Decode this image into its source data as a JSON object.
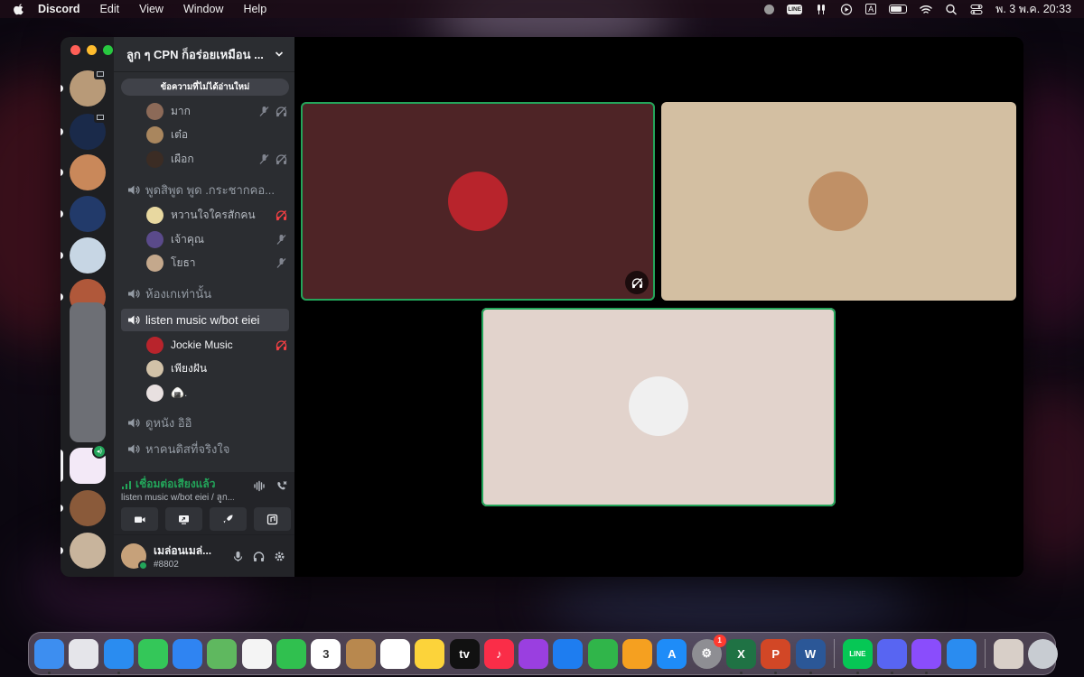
{
  "menubar": {
    "app_name": "Discord",
    "menus": [
      "Edit",
      "View",
      "Window",
      "Help"
    ],
    "status_icons": [
      "record-icon",
      "line-icon",
      "airpods-icon",
      "play-icon",
      "input-source-icon",
      "battery-icon",
      "wifi-icon",
      "search-icon",
      "control-center-icon"
    ],
    "input_source": "A",
    "clock": "พ. 3 พ.ค.  20:33"
  },
  "server_list": {
    "items": [
      {
        "name": "server-1",
        "color": "#b89a78",
        "screen_badge": true
      },
      {
        "name": "server-2",
        "color": "#1a2a4a",
        "screen_badge": true
      },
      {
        "name": "server-3",
        "color": "#c9885a"
      },
      {
        "name": "server-4",
        "color": "#223a6a"
      },
      {
        "name": "server-5",
        "color": "#c7d6e4"
      },
      {
        "name": "server-6",
        "color": "#b0583a"
      },
      {
        "name": "server-active",
        "color": "#f3e9f7",
        "voice_active": true
      },
      {
        "name": "server-8",
        "color": "#8a5a3a"
      },
      {
        "name": "server-9",
        "color": "#c8b49c"
      }
    ]
  },
  "guild": {
    "name": "ลูก ๆ CPN ก็อร่อยเหมือน ...",
    "unread_banner": "ข้อความที่ไม่ได้อ่านใหม่"
  },
  "channels": [
    {
      "type": "voice-user",
      "name": "มาก",
      "avatar_color": "#8c6a58",
      "muted": true,
      "deafened": true
    },
    {
      "type": "voice-user",
      "name": "เต๋อ",
      "avatar_color": "#a9865e"
    },
    {
      "type": "voice-user",
      "name": "เผือก",
      "avatar_color": "#3b2c24",
      "muted": true,
      "deafened": true
    },
    {
      "type": "voice-channel",
      "name": "พูดสิพูด พูด .กระชากคอ..."
    },
    {
      "type": "voice-user",
      "name": "หวานใจใครสักคน",
      "avatar_color": "#e8d8a0",
      "deafened_red": true
    },
    {
      "type": "voice-user",
      "name": "เจ้าคุณ",
      "avatar_color": "#5a4a8a",
      "muted": true
    },
    {
      "type": "voice-user",
      "name": "โยธา",
      "avatar_color": "#c4a88c",
      "muted": true
    },
    {
      "type": "voice-channel",
      "name": "ห้องเกเท่านั้น"
    },
    {
      "type": "voice-channel",
      "name": "listen music w/bot eiei",
      "active": true
    },
    {
      "type": "voice-user",
      "name": "Jockie Music",
      "avatar_color": "#b8242c",
      "deafened_red": true
    },
    {
      "type": "voice-user",
      "name": "เพียงฝัน",
      "avatar_color": "#d2c2a8"
    },
    {
      "type": "voice-user",
      "name": "🍙.",
      "avatar_color": "#e8e0e0"
    },
    {
      "type": "voice-channel",
      "name": "ดูหนัง อิอิ"
    },
    {
      "type": "voice-channel",
      "name": "หาคนดิสที่จริงใจ"
    }
  ],
  "voice_panel": {
    "status": "เชื่อมต่อเสียงแล้ว",
    "subtitle": "listen music w/bot eiei / ลูก...",
    "actions": [
      "camera-icon",
      "screen-share-icon",
      "activity-icon",
      "soundboard-icon"
    ]
  },
  "user_panel": {
    "name": "เมล่อนเมล่...",
    "tag": "#8802"
  },
  "stage": {
    "tiles": [
      {
        "name": "tile-jockie-music",
        "bg": "#4e2426",
        "speaking": true,
        "avatar_color": "#b8242c",
        "deafened": true
      },
      {
        "name": "tile-capybara",
        "bg": "#d3bfa2",
        "speaking": false,
        "avatar_color": "#c09066"
      },
      {
        "name": "tile-anime-user",
        "bg": "#e2d3cc",
        "speaking": true,
        "avatar_color": "#f0f0f0"
      }
    ],
    "speaking_color": "#23a55a"
  },
  "dock": {
    "apps": [
      {
        "name": "finder",
        "color": "#3d8ef0",
        "glyph": "",
        "running": true
      },
      {
        "name": "launchpad",
        "color": "#e5e5ea",
        "glyph": ""
      },
      {
        "name": "safari",
        "color": "#2a8cf0",
        "glyph": "",
        "running": true
      },
      {
        "name": "messages",
        "color": "#34c759",
        "glyph": ""
      },
      {
        "name": "mail",
        "color": "#2f84f2",
        "glyph": ""
      },
      {
        "name": "maps",
        "color": "#5fb85f",
        "glyph": ""
      },
      {
        "name": "photos",
        "color": "#f4f4f4",
        "glyph": ""
      },
      {
        "name": "facetime",
        "color": "#30c04f",
        "glyph": ""
      },
      {
        "name": "calendar",
        "color": "#ffffff",
        "glyph": "3"
      },
      {
        "name": "contacts",
        "color": "#b8884e",
        "glyph": ""
      },
      {
        "name": "reminders",
        "color": "#ffffff",
        "glyph": ""
      },
      {
        "name": "notes",
        "color": "#fcd33a",
        "glyph": ""
      },
      {
        "name": "apple-tv",
        "color": "#111111",
        "glyph": "tv"
      },
      {
        "name": "music",
        "color": "#fa2d48",
        "glyph": "♪"
      },
      {
        "name": "podcasts",
        "color": "#9a3fe0",
        "glyph": ""
      },
      {
        "name": "keynote",
        "color": "#1e7df0",
        "glyph": ""
      },
      {
        "name": "numbers",
        "color": "#30b54a",
        "glyph": ""
      },
      {
        "name": "pages",
        "color": "#f5a020",
        "glyph": ""
      },
      {
        "name": "app-store",
        "color": "#1e8cf8",
        "glyph": "A"
      },
      {
        "name": "system-preferences",
        "color": "#8e8e93",
        "glyph": "⚙",
        "badge": "1"
      },
      {
        "name": "excel",
        "color": "#1f7244",
        "glyph": "X",
        "running": true
      },
      {
        "name": "powerpoint",
        "color": "#d24726",
        "glyph": "P",
        "running": true
      },
      {
        "name": "word",
        "color": "#2b5797",
        "glyph": "W",
        "running": true
      },
      {
        "name": "line",
        "color": "#06c755",
        "glyph": "LINE",
        "running": true,
        "separator_before": true
      },
      {
        "name": "discord",
        "color": "#5865f2",
        "glyph": "",
        "running": true
      },
      {
        "name": "messenger",
        "color": "#8a4dfc",
        "glyph": "",
        "running": true
      },
      {
        "name": "safari-web-app",
        "color": "#2a8cf0",
        "glyph": ""
      },
      {
        "name": "downloads-stack",
        "color": "#d8cfc8",
        "glyph": "",
        "separator_before": true
      },
      {
        "name": "trash",
        "color": "#c8ccd2",
        "glyph": ""
      }
    ]
  }
}
